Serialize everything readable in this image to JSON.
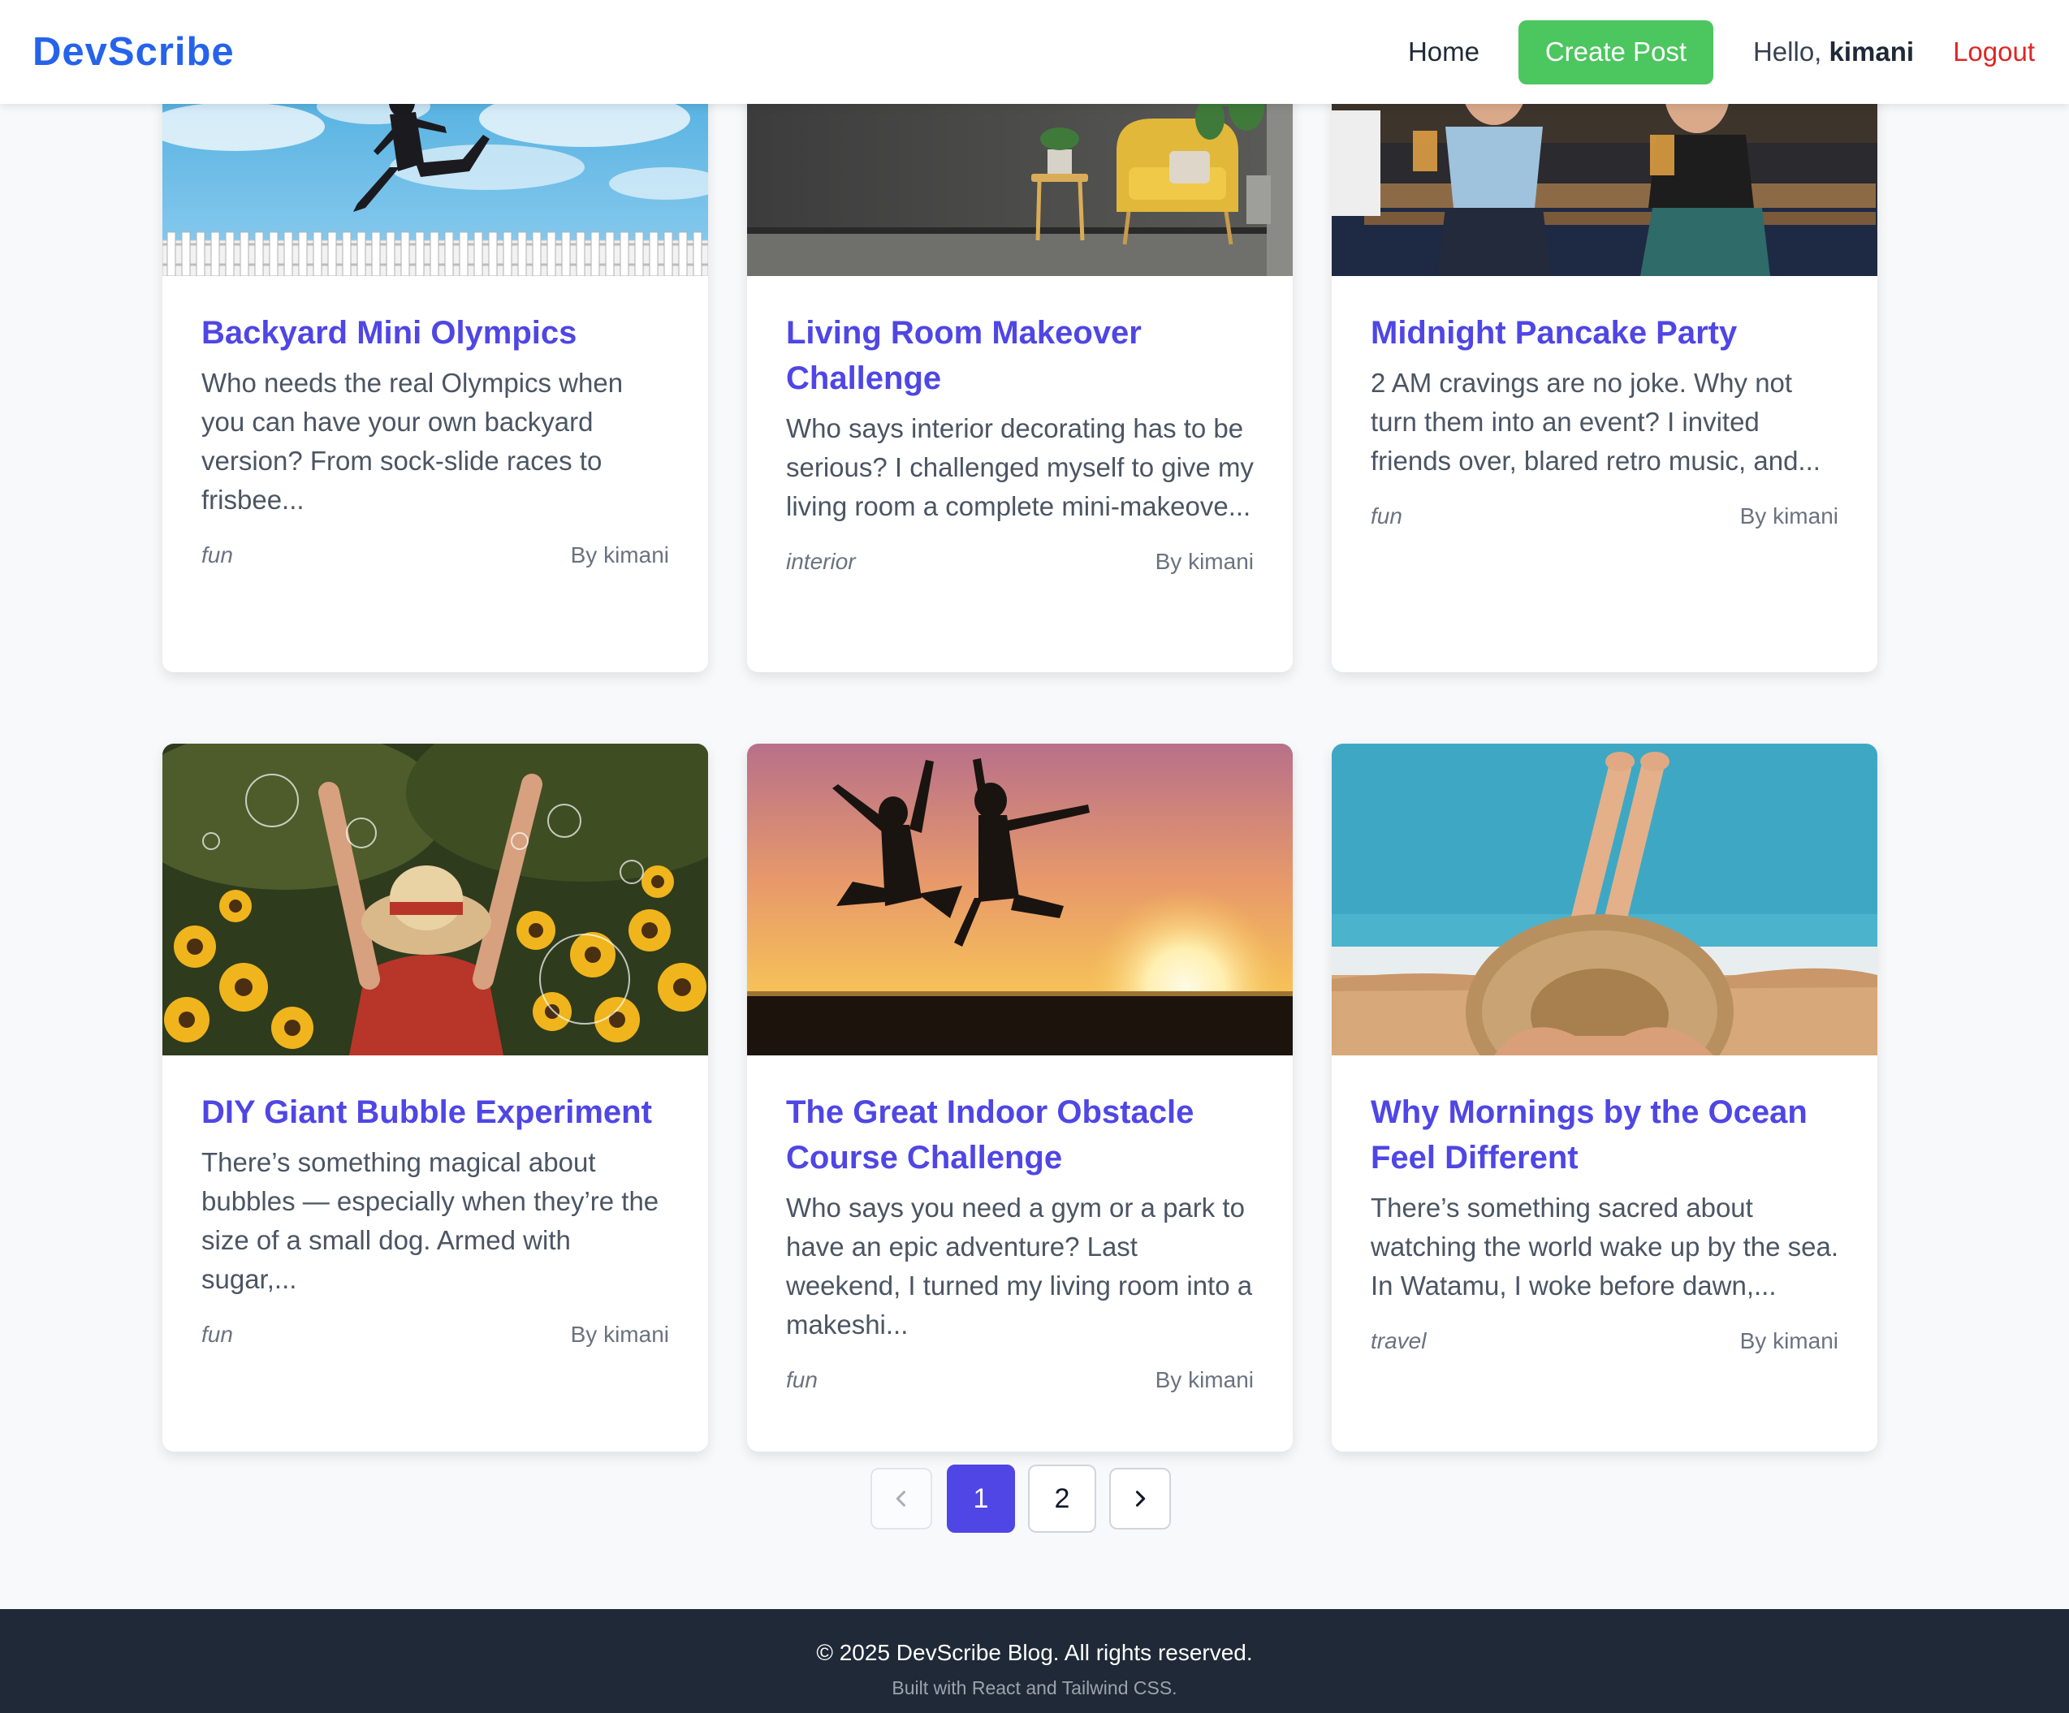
{
  "nav": {
    "brand": "DevScribe",
    "home": "Home",
    "create_post": "Create Post",
    "hello_prefix": "Hello, ",
    "username": "kimani",
    "logout": "Logout"
  },
  "posts": [
    {
      "title": "Backyard Mini Olympics",
      "excerpt": "Who needs the real Olympics when you can have your own backyard version? From sock-slide races to frisbee...",
      "tag": "fun",
      "author": "By kimani"
    },
    {
      "title": "Living Room Makeover Challenge",
      "excerpt": "Who says interior decorating has to be serious? I challenged myself to give my living room a complete mini-makeove...",
      "tag": "interior",
      "author": "By kimani"
    },
    {
      "title": "Midnight Pancake Party",
      "excerpt": "2 AM cravings are no joke. Why not turn them into an event? I invited friends over, blared retro music, and...",
      "tag": "fun",
      "author": "By kimani"
    },
    {
      "title": "DIY Giant Bubble Experiment",
      "excerpt": "There’s something magical about bubbles — especially when they’re the size of a small dog. Armed with sugar,...",
      "tag": "fun",
      "author": "By kimani"
    },
    {
      "title": "The Great Indoor Obstacle Course Challenge",
      "excerpt": "Who says you need a gym or a park to have an epic adventure? Last weekend, I turned my living room into a makeshi...",
      "tag": "fun",
      "author": "By kimani"
    },
    {
      "title": "Why Mornings by the Ocean Feel Different",
      "excerpt": "There’s something sacred about watching the world wake up by the sea. In Watamu, I woke before dawn,...",
      "tag": "travel",
      "author": "By kimani"
    }
  ],
  "pagination": {
    "prev_icon": "chevron-left-icon",
    "next_icon": "chevron-right-icon",
    "pages": [
      "1",
      "2"
    ],
    "current": "1"
  },
  "footer": {
    "copyright": "© 2025 DevScribe Blog. All rights reserved.",
    "built_with": "Built with React and Tailwind CSS."
  },
  "colors": {
    "brand": "#2563eb",
    "accent": "#4f46e5",
    "create_button": "#4cc65f",
    "logout": "#dc2626",
    "footer_bg": "#1f2937"
  }
}
